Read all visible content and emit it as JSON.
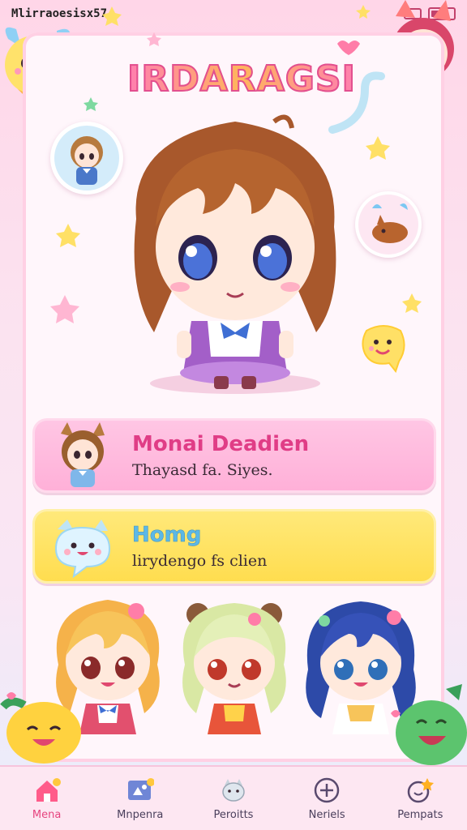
{
  "status_bar": {
    "text": "Mlirraoesisx57"
  },
  "app": {
    "title": "IRDARAGSI"
  },
  "cards": [
    {
      "title": "Monai Deadien",
      "subtitle": "Thayasd fa. Siyes."
    },
    {
      "title": "Homg",
      "subtitle": "lirydengo fs clien"
    }
  ],
  "tabs": [
    {
      "label": "Mena",
      "icon": "home-icon",
      "active": true
    },
    {
      "label": "Mnpenra",
      "icon": "image-icon",
      "active": false
    },
    {
      "label": "Peroitts",
      "icon": "cat-icon",
      "active": false
    },
    {
      "label": "Neriels",
      "icon": "plus-circle-icon",
      "active": false
    },
    {
      "label": "Pempats",
      "icon": "star-badge-icon",
      "active": false
    }
  ],
  "colors": {
    "accent": "#e6447f",
    "pink_card": "#ffb0d8",
    "yellow_card": "#ffdd4f",
    "background": "#ffd6e8"
  }
}
